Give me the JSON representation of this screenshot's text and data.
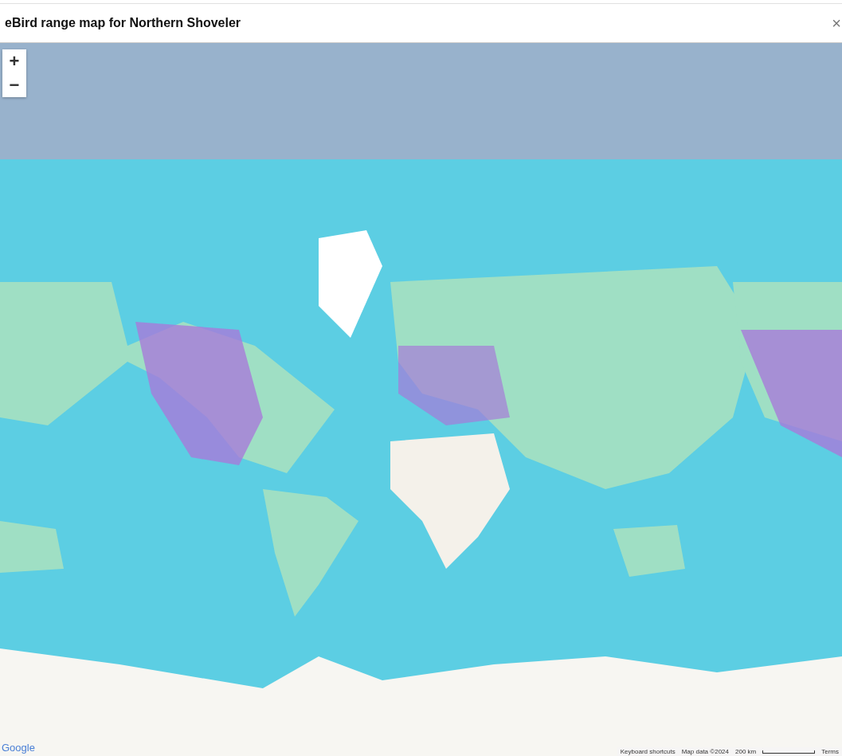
{
  "dialog": {
    "title": "eBird range map for Northern Shoveler",
    "close": "×"
  },
  "map": {
    "zoom_in": "+",
    "zoom_out": "−",
    "logo": "Google",
    "attribution": [
      "Keyboard shortcuts",
      "Map data ©2024"
    ],
    "scale": "200 km",
    "terms": "Terms"
  }
}
